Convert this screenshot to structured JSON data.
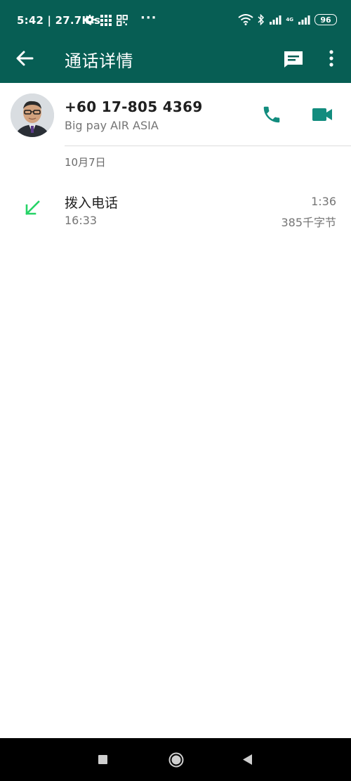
{
  "status_bar": {
    "time_speed": "5:42 | 27.7K/s",
    "dots": "···",
    "network": "4G",
    "battery": "96"
  },
  "app_bar": {
    "title": "通话详情"
  },
  "contact": {
    "number": "+60 17-805 4369",
    "name": "Big pay AIR ASIA"
  },
  "date_label": "10月7日",
  "call": {
    "type": "拨入电话",
    "time": "16:33",
    "duration": "1:36",
    "size": "385千字节"
  },
  "colors": {
    "header": "#075e54",
    "accent": "#128c7e",
    "incoming": "#25d366"
  },
  "icons": [
    "back-arrow-icon",
    "new-message-icon",
    "more-vert-icon",
    "voice-call-icon",
    "video-call-icon",
    "incoming-arrow-icon"
  ]
}
